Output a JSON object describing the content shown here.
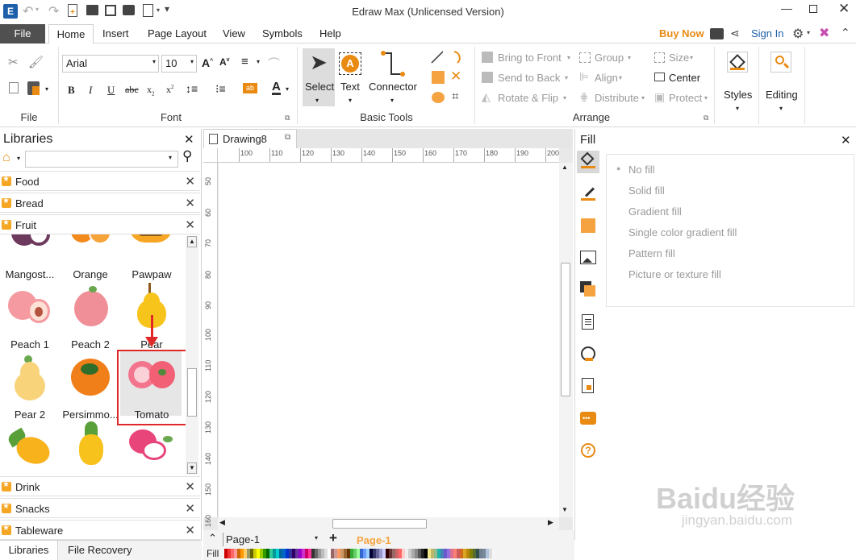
{
  "window": {
    "title": "Edraw Max (Unlicensed Version)"
  },
  "menu": {
    "file": "File",
    "tabs": [
      "Home",
      "Insert",
      "Page Layout",
      "View",
      "Symbols",
      "Help"
    ],
    "buy_now": "Buy Now",
    "sign_in": "Sign In"
  },
  "ribbon": {
    "groups": {
      "file": "File",
      "font": "Font",
      "basic_tools": "Basic Tools",
      "arrange": "Arrange"
    },
    "font_name": "Arial",
    "font_size": "10",
    "tools": {
      "select": "Select",
      "text": "Text",
      "connector": "Connector"
    },
    "arrange": {
      "bring_to_front": "Bring to Front",
      "send_to_back": "Send to Back",
      "rotate_flip": "Rotate & Flip",
      "group": "Group",
      "align": "Align",
      "distribute": "Distribute",
      "size": "Size",
      "center": "Center",
      "protect": "Protect"
    },
    "styles": "Styles",
    "editing": "Editing",
    "accent": "#e98a12"
  },
  "libraries": {
    "title": "Libraries",
    "categories_top": [
      "Food",
      "Bread",
      "Fruit"
    ],
    "shapes": [
      "Mangost...",
      "Orange",
      "Pawpaw",
      "Peach 1",
      "Peach 2",
      "Pear",
      "Pear 2",
      "Persimmo...",
      "Tomato"
    ],
    "categories_bottom": [
      "Drink",
      "Snacks",
      "Tableware"
    ],
    "tabs": {
      "libraries": "Libraries",
      "file_recovery": "File Recovery"
    }
  },
  "document": {
    "tab": "Drawing8",
    "ruler_h": [
      "100",
      "110",
      "120",
      "130",
      "140",
      "150",
      "160",
      "170",
      "180",
      "190",
      "200"
    ],
    "ruler_v": [
      "50",
      "60",
      "70",
      "80",
      "90",
      "100",
      "110",
      "120",
      "130",
      "140",
      "150",
      "160"
    ]
  },
  "fill_panel": {
    "title": "Fill",
    "options": [
      "No fill",
      "Solid fill",
      "Gradient fill",
      "Single color gradient fill",
      "Pattern fill",
      "Picture or texture fill"
    ]
  },
  "bottom": {
    "page_select": "Page-1",
    "page_tab": "Page-1",
    "fill_label": "Fill"
  },
  "watermark": {
    "brand": "Baidu经验",
    "url": "jingyan.baidu.com"
  }
}
